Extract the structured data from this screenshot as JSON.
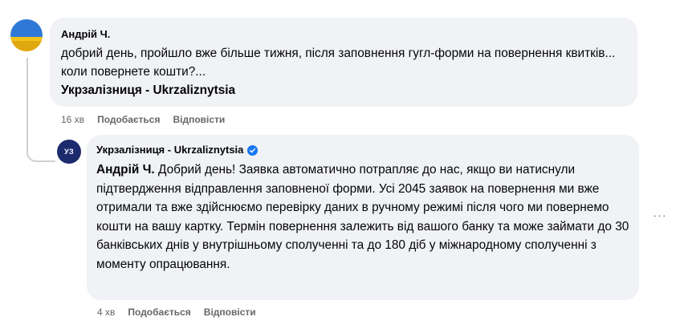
{
  "comment": {
    "author": "Андрій Ч.",
    "text": "добрий день, пройшло вже більше тижня, після заповнення гугл-форми на повернення квитків... коли повернете кошти?...",
    "tag": "Укрзалізниця - Ukrzaliznytsia",
    "time": "16 хв",
    "like_label": "Подобається",
    "reply_label": "Відповісти"
  },
  "reply": {
    "author": "Укрзалізниця - Ukrzaliznytsia",
    "avatar_text": "УЗ",
    "mention": "Андрій Ч.",
    "text": "Добрий день! Заявка автоматично потрапляє до нас, якщо ви натиснули підтвердження відправлення заповненої форми. Усі 2045 заявок на повернення ми вже отримали та вже здійснюємо перевірку даних в ручному режимі після чого ми повернемо кошти на вашу картку. Термін повернення залежить від вашого банку та може займати до 30 банківських днів у внутрішньому сполученні та до 180 діб у міжнародному сполученні з моменту опрацювання.",
    "time": "4 хв",
    "like_label": "Подобається",
    "reply_label": "Відповісти"
  },
  "more_label": "···",
  "colors": {
    "bubble": "#f0f2f5",
    "meta": "#65676b",
    "verified": "#1877f2",
    "logo_bg": "#1c2a6e"
  }
}
